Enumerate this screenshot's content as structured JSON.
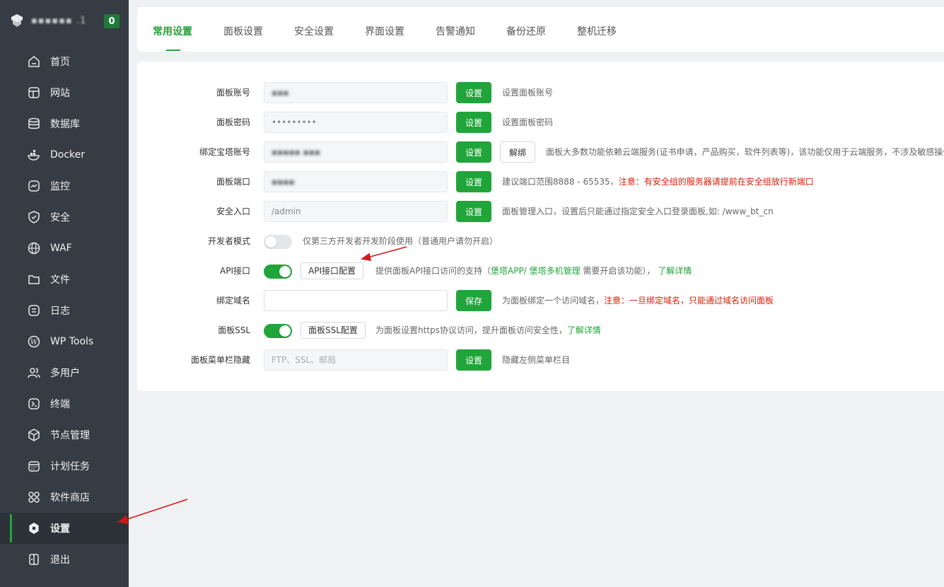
{
  "sidebar": {
    "brand_name": "▪▪▪▪▪▪ .1",
    "badge": "0",
    "items": [
      {
        "label": "首页",
        "icon": "home-icon"
      },
      {
        "label": "网站",
        "icon": "website-icon"
      },
      {
        "label": "数据库",
        "icon": "database-icon"
      },
      {
        "label": "Docker",
        "icon": "docker-icon"
      },
      {
        "label": "监控",
        "icon": "monitor-icon"
      },
      {
        "label": "安全",
        "icon": "shield-icon"
      },
      {
        "label": "WAF",
        "icon": "globe-icon"
      },
      {
        "label": "文件",
        "icon": "folder-icon"
      },
      {
        "label": "日志",
        "icon": "log-icon"
      },
      {
        "label": "WP Tools",
        "icon": "wordpress-icon"
      },
      {
        "label": "多用户",
        "icon": "users-icon"
      },
      {
        "label": "终端",
        "icon": "terminal-icon"
      },
      {
        "label": "节点管理",
        "icon": "cube-icon"
      },
      {
        "label": "计划任务",
        "icon": "calendar-icon"
      },
      {
        "label": "软件商店",
        "icon": "apps-icon"
      },
      {
        "label": "设置",
        "icon": "gear-icon",
        "active": true
      },
      {
        "label": "退出",
        "icon": "logout-icon"
      }
    ]
  },
  "tabs": [
    "常用设置",
    "面板设置",
    "安全设置",
    "界面设置",
    "告警通知",
    "备份还原",
    "整机迁移"
  ],
  "form": {
    "account": {
      "label": "面板账号",
      "value": "▪▪▪",
      "button": "设置",
      "hint": "设置面板账号"
    },
    "password": {
      "label": "面板密码",
      "value": "•••••••••",
      "button": "设置",
      "hint": "设置面板密码"
    },
    "bind_bt": {
      "label": "绑定宝塔账号",
      "value": "▪▪▪▪▪ ▪▪▪",
      "button": "设置",
      "unbind": "解绑",
      "hint": "面板大多数功能依赖云端服务(证书申请，产品购买，软件列表等)，该功能仅用于云端服务，不涉及敏感操作"
    },
    "port": {
      "label": "面板端口",
      "value": "▪▪▪▪",
      "button": "设置",
      "hint": "建议端口范围8888 - 65535，",
      "hint_red": "注意：有安全组的服务器请提前在安全组放行新端口"
    },
    "entry": {
      "label": "安全入口",
      "value": "/admin",
      "button": "设置",
      "hint": "面板管理入口，设置后只能通过指定安全入口登录面板,如: /www_bt_cn"
    },
    "dev_mode": {
      "label": "开发者模式",
      "hint": "仅第三方开发者开发阶段使用（普通用户请勿开启）"
    },
    "api": {
      "label": "API接口",
      "config": "API接口配置",
      "hint_a": "提供面板API接口访问的支持（",
      "link1": "堡塔APP/",
      "link2": "堡塔多机管理",
      "hint_b": "需要开启该功能），",
      "link3": "了解详情"
    },
    "domain": {
      "label": "绑定域名",
      "value": "",
      "button": "保存",
      "hint": "为面板绑定一个访问域名，",
      "hint_red": "注意：一旦绑定域名，只能通过域名访问面板"
    },
    "ssl": {
      "label": "面板SSL",
      "config": "面板SSL配置",
      "hint": "为面板设置https协议访问，提升面板访问安全性，",
      "link": "了解详情"
    },
    "menu_hide": {
      "label": "面板菜单栏隐藏",
      "placeholder": "FTP、SSL、邮局",
      "button": "设置",
      "hint": "隐藏左侧菜单栏目"
    }
  },
  "colors": {
    "accent": "#20a53a",
    "sidebar": "#363c43",
    "warning": "#d81e06",
    "arrow": "#d11a1a"
  }
}
